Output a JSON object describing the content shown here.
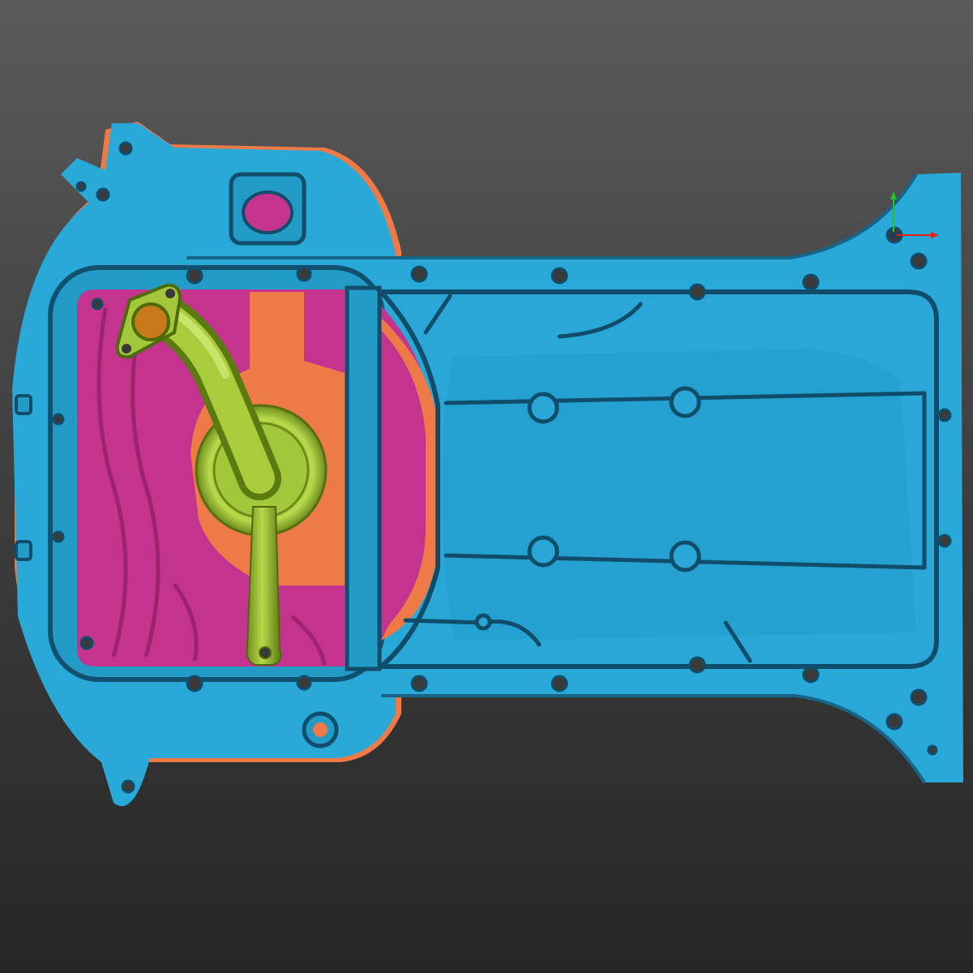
{
  "viewport": {
    "background_top": "#5a5a5a",
    "background_bottom": "#262626"
  },
  "model": {
    "parts": [
      {
        "name": "oil-pan-body",
        "color": "#29a9d8"
      },
      {
        "name": "sump-well-region",
        "color": "#c4338e"
      },
      {
        "name": "deviation-region",
        "color": "#ee7a47"
      },
      {
        "name": "oil-pickup-tube",
        "color": "#9bc232"
      }
    ]
  },
  "axis_gizmo": {
    "x_axis_color": "#e0201c",
    "y_axis_color": "#22c42a",
    "origin_color": "#1a3a60"
  }
}
